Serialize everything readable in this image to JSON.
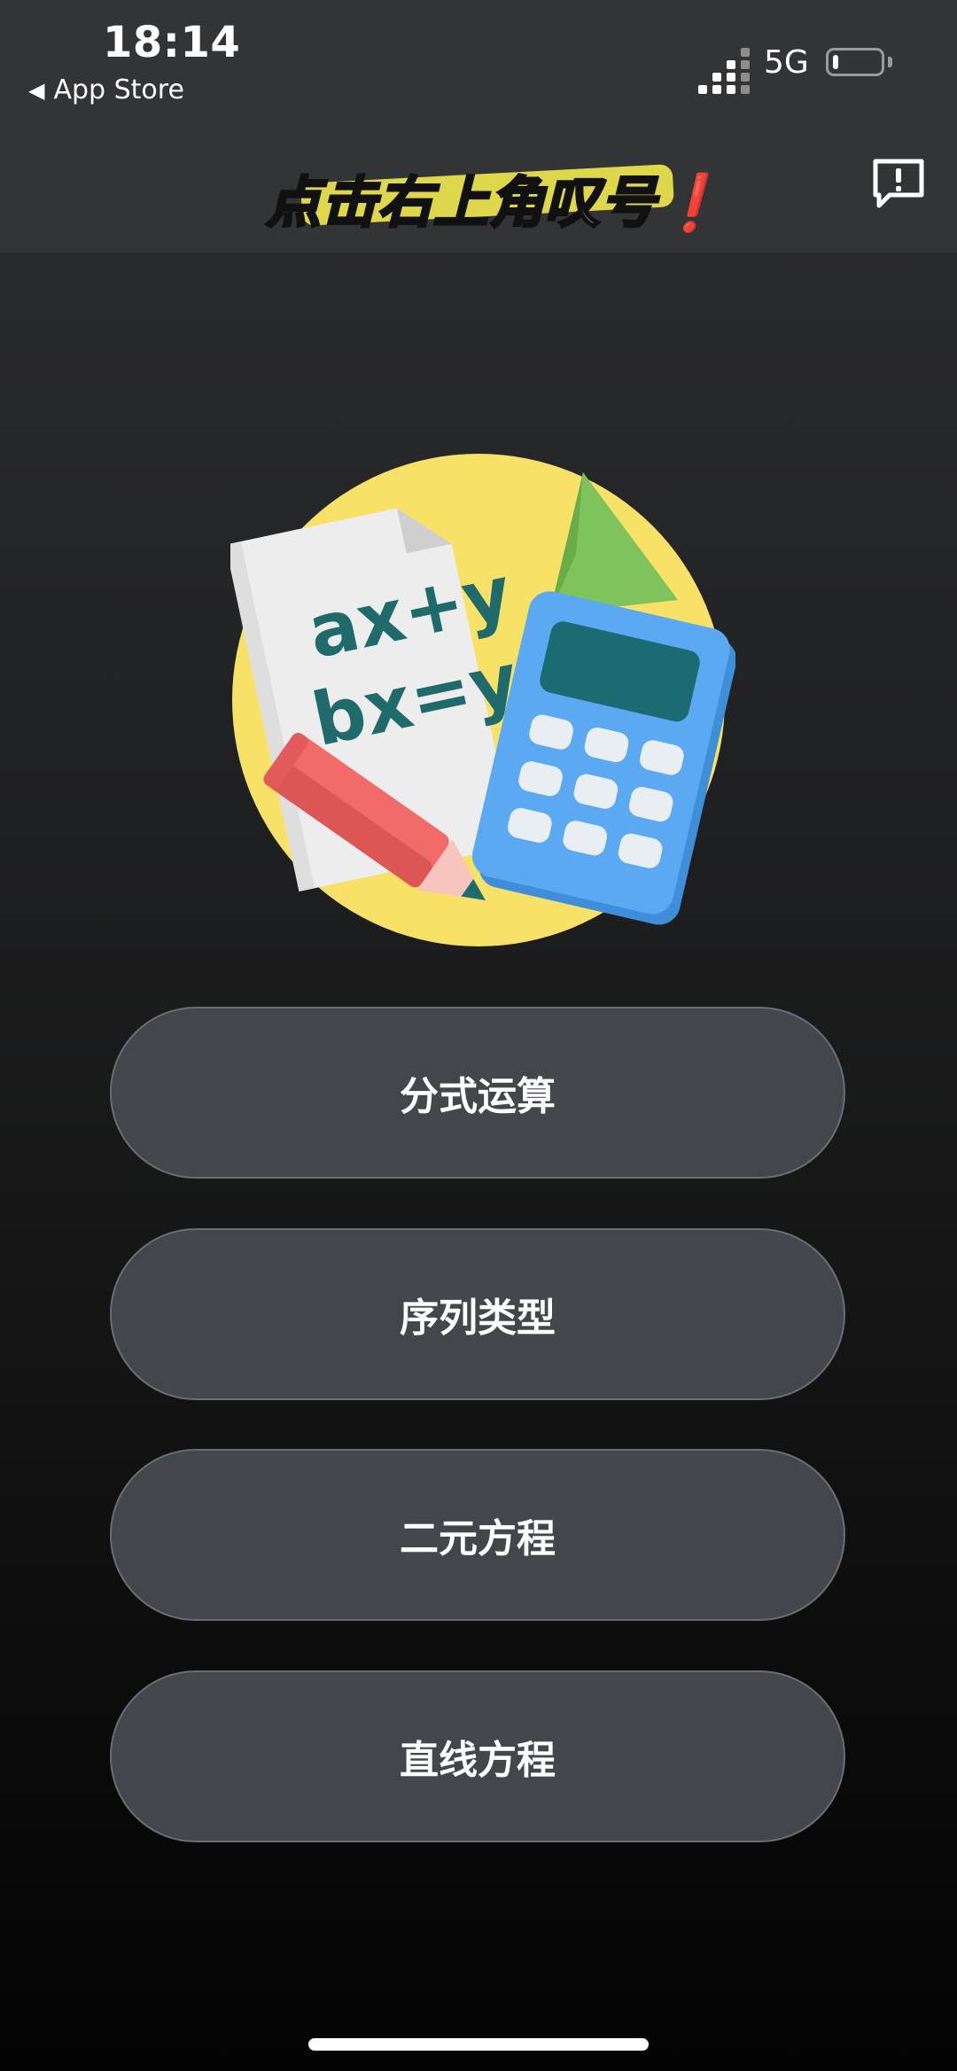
{
  "status_bar": {
    "time": "18:14",
    "back_label": "App Store",
    "network": "5G",
    "battery_level": 0.12
  },
  "nav": {
    "overlay_title": "点击右上角叹号❗️",
    "feedback_icon": "exclamation-bubble-icon"
  },
  "hero": {
    "formula_line1": "ax+y",
    "formula_line2": "bx=y",
    "icon": "math-tools-illustration"
  },
  "menu": {
    "items": [
      {
        "label": "分式运算"
      },
      {
        "label": "序列类型"
      },
      {
        "label": "二元方程"
      },
      {
        "label": "直线方程"
      }
    ]
  },
  "colors": {
    "background_top": "#2e2f31",
    "background_bottom": "#030303",
    "button_fill": "#43474c",
    "button_border": "#6a6e73",
    "sticker_highlight": "#f2e94e"
  }
}
